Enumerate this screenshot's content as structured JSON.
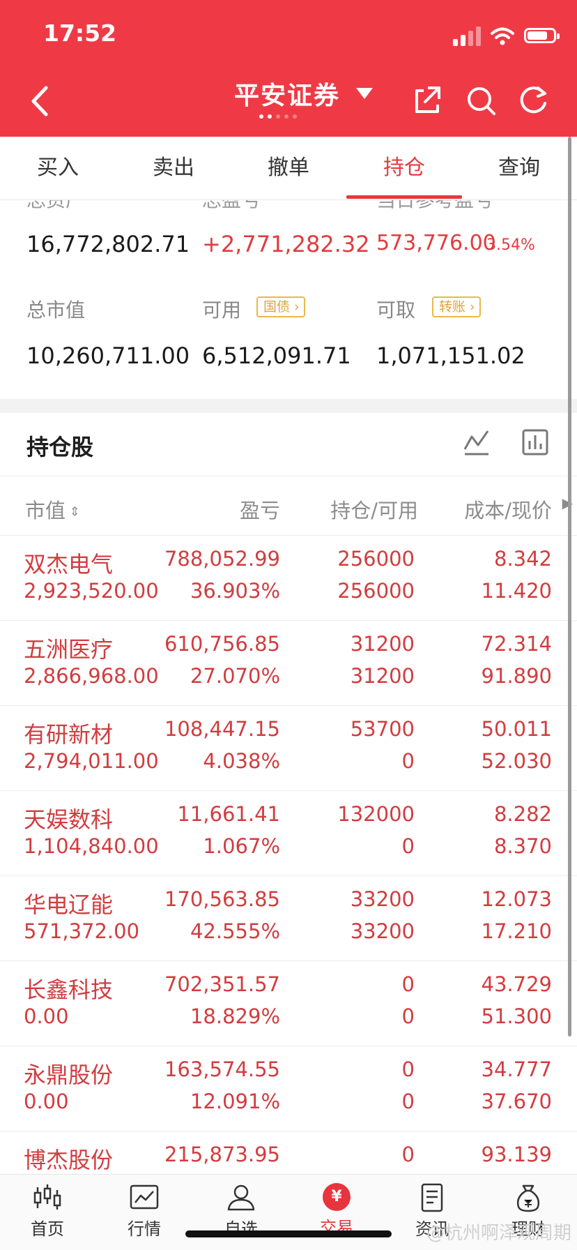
{
  "status": {
    "time": "17:52"
  },
  "nav": {
    "title": "平安证券"
  },
  "tabs": [
    "买入",
    "卖出",
    "撤单",
    "持仓",
    "查询"
  ],
  "summary": {
    "top_labels_partial": [
      "总资产",
      "总盈亏",
      "当日参考盈亏"
    ],
    "total_assets": "16,772,802.71",
    "total_pl": "+2,771,282.32",
    "today_pl": "573,776.00",
    "today_pl_pct": "3.54%",
    "market_value_label": "总市值",
    "market_value": "10,260,711.00",
    "available_label": "可用",
    "available_tag": "国债",
    "available": "6,512,091.71",
    "withdrawable_label": "可取",
    "withdrawable_tag": "转账",
    "withdrawable": "1,071,151.02"
  },
  "holdings": {
    "title": "持仓股",
    "columns": [
      "市值",
      "盈亏",
      "持仓/可用",
      "成本/现价"
    ],
    "rows": [
      {
        "name": "双杰电气",
        "market_value": "2,923,520.00",
        "pl": "788,052.99",
        "pl_pct": "36.903%",
        "position": "256000",
        "available": "256000",
        "cost": "8.342",
        "price": "11.420"
      },
      {
        "name": "五洲医疗",
        "market_value": "2,866,968.00",
        "pl": "610,756.85",
        "pl_pct": "27.070%",
        "position": "31200",
        "available": "31200",
        "cost": "72.314",
        "price": "91.890"
      },
      {
        "name": "有研新材",
        "market_value": "2,794,011.00",
        "pl": "108,447.15",
        "pl_pct": "4.038%",
        "position": "53700",
        "available": "0",
        "cost": "50.011",
        "price": "52.030"
      },
      {
        "name": "天娱数科",
        "market_value": "1,104,840.00",
        "pl": "11,661.41",
        "pl_pct": "1.067%",
        "position": "132000",
        "available": "0",
        "cost": "8.282",
        "price": "8.370"
      },
      {
        "name": "华电辽能",
        "market_value": "571,372.00",
        "pl": "170,563.85",
        "pl_pct": "42.555%",
        "position": "33200",
        "available": "33200",
        "cost": "12.073",
        "price": "17.210"
      },
      {
        "name": "长鑫科技",
        "market_value": "0.00",
        "pl": "702,351.57",
        "pl_pct": "18.829%",
        "position": "0",
        "available": "0",
        "cost": "43.729",
        "price": "51.300"
      },
      {
        "name": "永鼎股份",
        "market_value": "0.00",
        "pl": "163,574.55",
        "pl_pct": "12.091%",
        "position": "0",
        "available": "0",
        "cost": "34.777",
        "price": "37.670"
      },
      {
        "name": "博杰股份",
        "market_value": "",
        "pl": "215,873.95",
        "pl_pct": "",
        "position": "0",
        "available": "",
        "cost": "93.139",
        "price": ""
      }
    ]
  },
  "bottom_nav": [
    {
      "label": "首页",
      "icon": "candlestick-icon"
    },
    {
      "label": "行情",
      "icon": "line-chart-icon"
    },
    {
      "label": "自选",
      "icon": "user-star-icon"
    },
    {
      "label": "交易",
      "icon": "yuan-circle-icon"
    },
    {
      "label": "资讯",
      "icon": "document-icon"
    },
    {
      "label": "理财",
      "icon": "money-bag-icon"
    }
  ],
  "watermark": "@杭州啊泽观周期",
  "colors": {
    "brand_red": "#ef3a45",
    "gain_red": "#d23c3f",
    "tag_gold": "#e0a43a"
  }
}
